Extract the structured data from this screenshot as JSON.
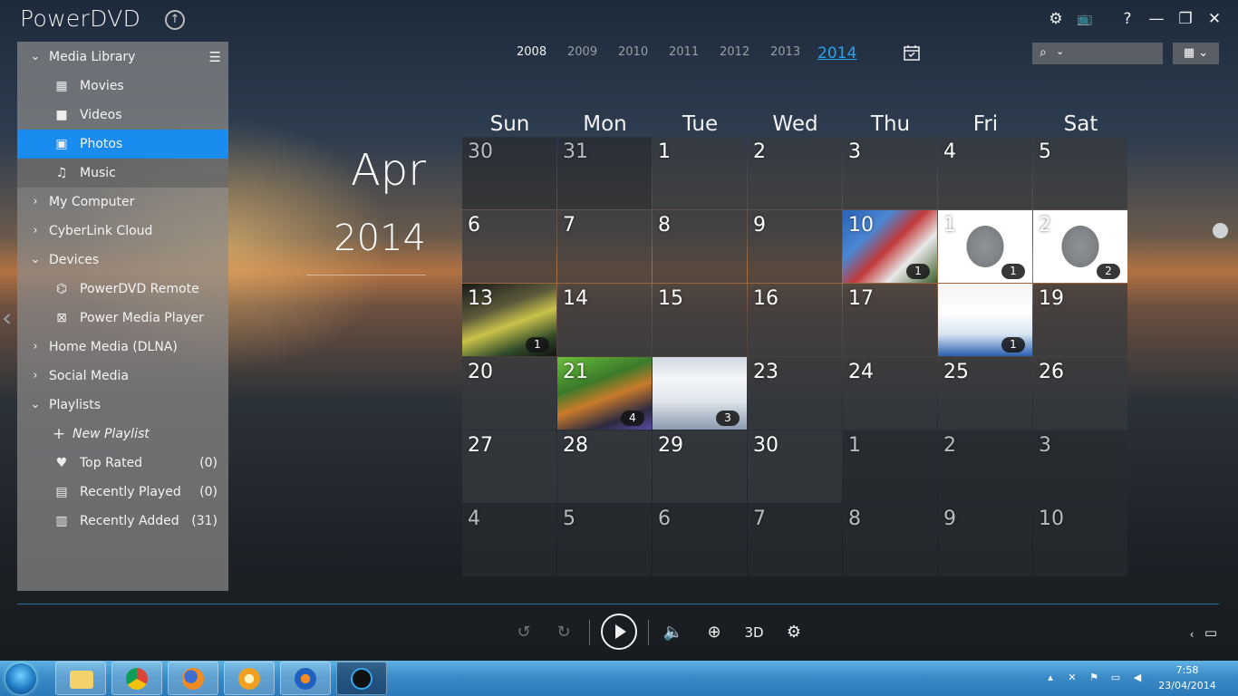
{
  "app": {
    "title": "PowerDVD"
  },
  "window_controls": {
    "settings": "⚙",
    "tv_mode": "📺",
    "help": "?",
    "minimize": "—",
    "restore": "❐",
    "close": "✕"
  },
  "sidebar": {
    "media_library": "Media Library",
    "movies": "Movies",
    "videos": "Videos",
    "photos": "Photos",
    "music": "Music",
    "my_computer": "My Computer",
    "cyberlink_cloud": "CyberLink Cloud",
    "devices": "Devices",
    "powerdvd_remote": "PowerDVD Remote",
    "power_media_player": "Power Media Player",
    "home_media": "Home Media (DLNA)",
    "social_media": "Social Media",
    "playlists": "Playlists",
    "new_playlist": "New Playlist",
    "top_rated": "Top Rated",
    "top_rated_count": "(0)",
    "recently_played": "Recently Played",
    "recently_played_count": "(0)",
    "recently_added": "Recently Added",
    "recently_added_count": "(31)"
  },
  "years": [
    "2008",
    "2009",
    "2010",
    "2011",
    "2012",
    "2013",
    "2014"
  ],
  "calendar": {
    "month": "Apr",
    "year": "2014",
    "day_names": [
      "Sun",
      "Mon",
      "Tue",
      "Wed",
      "Thu",
      "Fri",
      "Sat"
    ],
    "weeks": [
      [
        "30",
        "31",
        "1",
        "2",
        "3",
        "4",
        "5"
      ],
      [
        "6",
        "7",
        "8",
        "9",
        "10",
        "1",
        "2"
      ],
      [
        "13",
        "14",
        "15",
        "16",
        "17",
        "",
        "19"
      ],
      [
        "20",
        "21",
        "",
        "23",
        "24",
        "25",
        "26"
      ],
      [
        "27",
        "28",
        "29",
        "30",
        "1",
        "2",
        "3"
      ],
      [
        "4",
        "5",
        "6",
        "7",
        "8",
        "9",
        "10"
      ]
    ],
    "photo_counts": {
      "10": "1",
      "11": "1",
      "12": "2",
      "13": "1",
      "18": "1",
      "21": "4",
      "22": "3"
    }
  },
  "player": {
    "three_d": "3D"
  },
  "taskbar": {
    "time": "7:58",
    "date": "23/04/2014"
  },
  "colors": {
    "accent": "#1a8cf0",
    "year_selected": "#2aa2f0"
  }
}
